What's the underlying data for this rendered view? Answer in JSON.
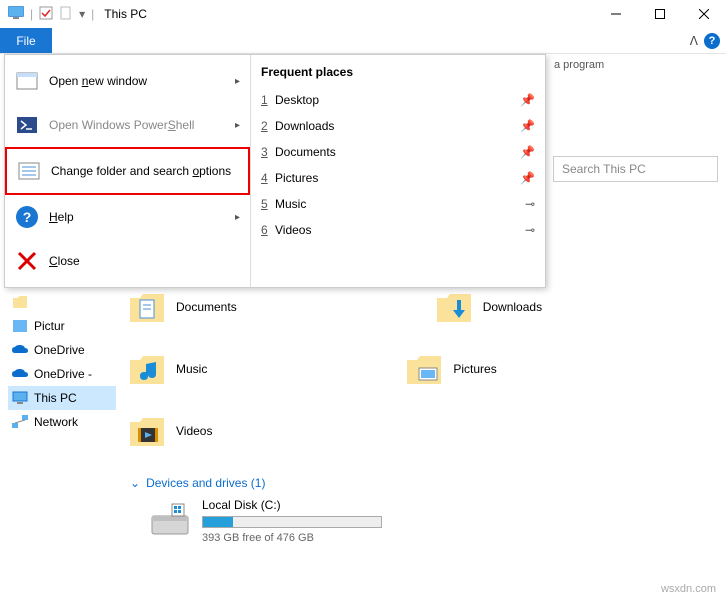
{
  "window": {
    "title": "This PC"
  },
  "ribbon": {
    "file": "File",
    "hint": "a program"
  },
  "search": {
    "placeholder": "Search This PC"
  },
  "file_menu": {
    "open_new_window": "Open new window",
    "powershell": "Open Windows PowerShell",
    "change_options": "Change folder and search options",
    "help": "Help",
    "close": "Close",
    "frequent_header": "Frequent places",
    "places": [
      {
        "n": "1",
        "label": "Desktop",
        "pin": "pin"
      },
      {
        "n": "2",
        "label": "Downloads",
        "pin": "pin"
      },
      {
        "n": "3",
        "label": "Documents",
        "pin": "pin"
      },
      {
        "n": "4",
        "label": "Pictures",
        "pin": "pin"
      },
      {
        "n": "5",
        "label": "Music",
        "pin": "unpin"
      },
      {
        "n": "6",
        "label": "Videos",
        "pin": "unpin"
      }
    ]
  },
  "sidebar": {
    "pictures": "Pictur",
    "onedrive1": "OneDrive",
    "onedrive2": "OneDrive -",
    "thispc": "This PC",
    "network": "Network"
  },
  "main": {
    "documents": "Documents",
    "downloads": "Downloads",
    "music": "Music",
    "pictures": "Pictures",
    "videos": "Videos"
  },
  "section": {
    "devices": "Devices and drives (1)"
  },
  "drive": {
    "name": "Local Disk (C:)",
    "space": "393 GB free of 476 GB"
  },
  "watermark": "wsxdn.com"
}
